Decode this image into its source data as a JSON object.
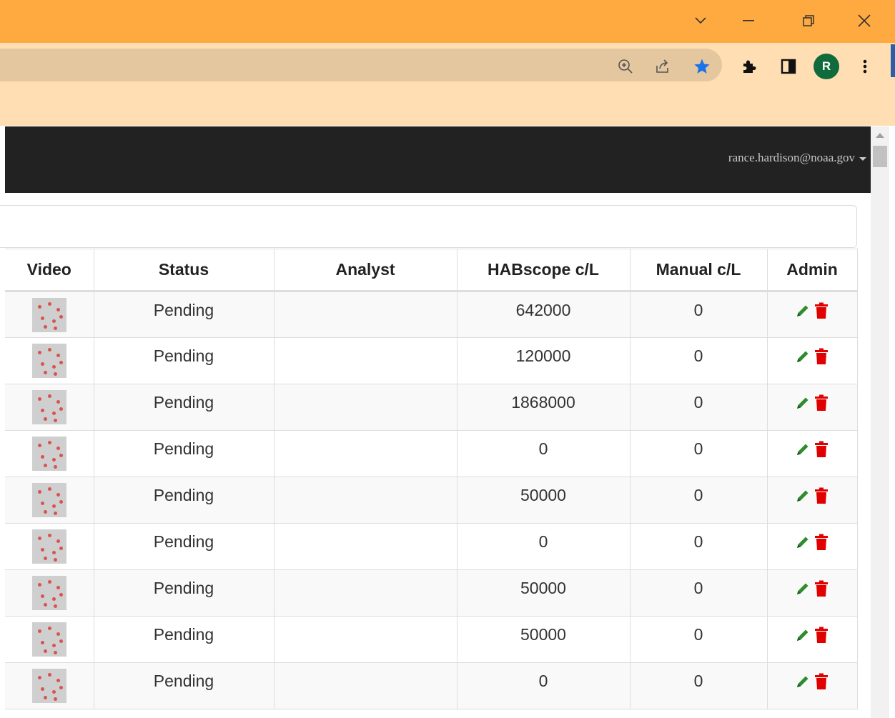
{
  "browser": {
    "window_controls": [
      "chevron-down-icon",
      "minimize-icon",
      "restore-icon",
      "close-icon"
    ],
    "toolbar_icons": [
      "zoom-icon",
      "share-icon",
      "star-icon",
      "extensions-icon",
      "side-panel-icon",
      "profile-avatar",
      "menu-kebab-icon"
    ],
    "profile_initial": "R",
    "colors": {
      "titlebar": "#ffa941",
      "toolbar": "#ffdeb3",
      "omnibox": "#e4c69f",
      "star": "#1a73e8"
    }
  },
  "navbar": {
    "user_email": "rance.hardison@noaa.gov",
    "background": "#222222"
  },
  "table": {
    "columns": [
      "Video",
      "Status",
      "Analyst",
      "HABscope c/L",
      "Manual c/L",
      "Admin"
    ],
    "rows": [
      {
        "status": "Pending",
        "analyst": "",
        "habscope": "642000",
        "manual": "0"
      },
      {
        "status": "Pending",
        "analyst": "",
        "habscope": "120000",
        "manual": "0"
      },
      {
        "status": "Pending",
        "analyst": "",
        "habscope": "1868000",
        "manual": "0"
      },
      {
        "status": "Pending",
        "analyst": "",
        "habscope": "0",
        "manual": "0"
      },
      {
        "status": "Pending",
        "analyst": "",
        "habscope": "50000",
        "manual": "0"
      },
      {
        "status": "Pending",
        "analyst": "",
        "habscope": "0",
        "manual": "0"
      },
      {
        "status": "Pending",
        "analyst": "",
        "habscope": "50000",
        "manual": "0"
      },
      {
        "status": "Pending",
        "analyst": "",
        "habscope": "50000",
        "manual": "0"
      },
      {
        "status": "Pending",
        "analyst": "",
        "habscope": "0",
        "manual": "0"
      }
    ],
    "admin_icons": [
      "pencil-edit-icon",
      "trash-delete-icon"
    ],
    "colors": {
      "edit": "#2e8b2e",
      "delete": "#e00000"
    }
  }
}
